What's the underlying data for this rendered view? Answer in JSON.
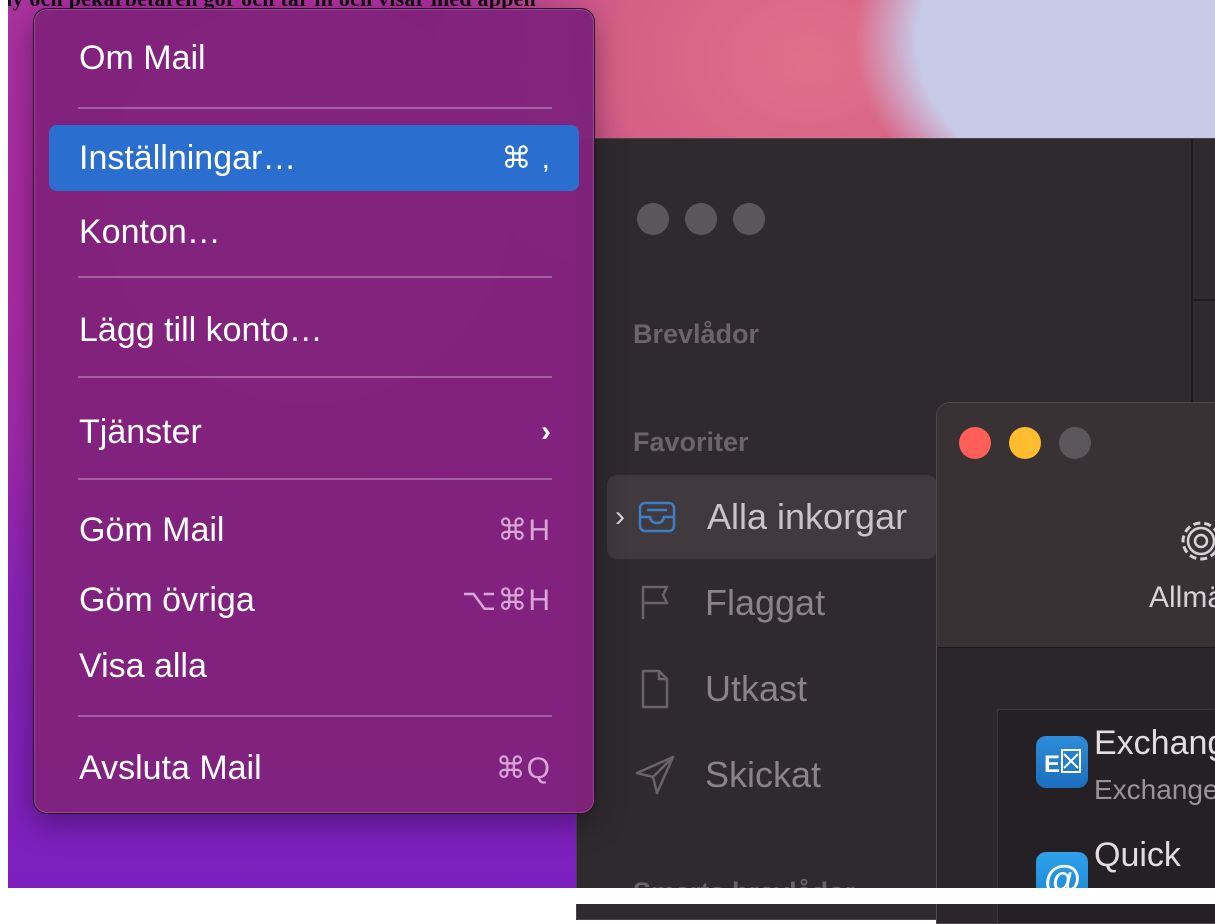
{
  "top_text": "ny och pekarbetaren gör och tar in och visar med appen",
  "menu": {
    "items": [
      {
        "label": "Om Mail",
        "shortcut": ""
      },
      {
        "label": "Inställningar…",
        "shortcut": "⌘ ,"
      },
      {
        "label": "Konton…",
        "shortcut": ""
      },
      {
        "label": "Lägg till konto…",
        "shortcut": ""
      },
      {
        "label": "Tjänster",
        "shortcut": "",
        "submenu": true
      },
      {
        "label": "Göm Mail",
        "shortcut": "⌘H"
      },
      {
        "label": "Göm övriga",
        "shortcut": "⌥⌘H"
      },
      {
        "label": "Visa alla",
        "shortcut": ""
      },
      {
        "label": "Avsluta Mail",
        "shortcut": "⌘Q"
      }
    ],
    "submenu_arrow": "›",
    "highlight_color": "#2a6fd0"
  },
  "sidebar": {
    "headings": {
      "mailboxes": "Brevlådor",
      "favorites": "Favoriter",
      "smart": "Smarta brevlådor"
    },
    "items": [
      {
        "label": "Alla inkorgar",
        "icon": "inbox-tray-icon",
        "selected": true
      },
      {
        "label": "Flaggat",
        "icon": "flag-icon"
      },
      {
        "label": "Utkast",
        "icon": "document-icon"
      },
      {
        "label": "Skickat",
        "icon": "paper-plane-icon"
      }
    ]
  },
  "settings": {
    "tab_general": "Allmänt",
    "accounts": [
      {
        "name": "Exchange",
        "type": "Exchange",
        "icon": "exchange-icon"
      },
      {
        "name": "Quick",
        "icon": "at-sign-icon"
      }
    ]
  }
}
